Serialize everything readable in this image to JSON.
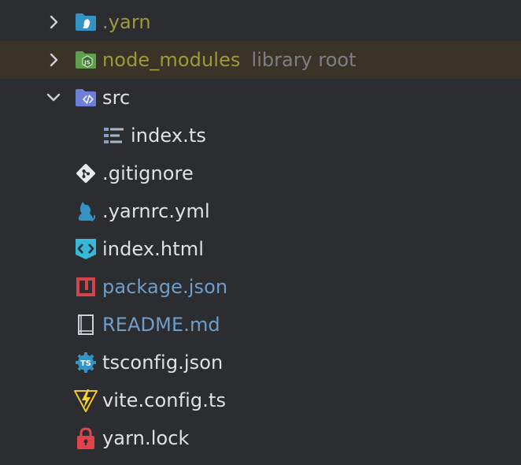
{
  "project_tree": {
    "items": [
      {
        "label": ".yarn",
        "icon": "folder-yarn-icon",
        "expanded": false,
        "status": "excluded"
      },
      {
        "label": "node_modules",
        "hint": "library root",
        "icon": "folder-node-modules-icon",
        "expanded": false,
        "status": "excluded",
        "selected": true
      },
      {
        "label": "src",
        "icon": "folder-src-icon",
        "expanded": true
      },
      {
        "label": "index.ts",
        "icon": "typescript-file-icon"
      },
      {
        "label": ".gitignore",
        "icon": "git-icon"
      },
      {
        "label": ".yarnrc.yml",
        "icon": "yarn-cat-icon"
      },
      {
        "label": "index.html",
        "icon": "html-file-icon"
      },
      {
        "label": "package.json",
        "icon": "npm-icon",
        "status": "modified"
      },
      {
        "label": "README.md",
        "icon": "readme-book-icon",
        "status": "modified"
      },
      {
        "label": "tsconfig.json",
        "icon": "tsconfig-icon"
      },
      {
        "label": "vite.config.ts",
        "icon": "vite-icon"
      },
      {
        "label": "yarn.lock",
        "icon": "lock-icon"
      }
    ]
  },
  "colors": {
    "background": "#2b2d30",
    "selected_row": "#3a3327",
    "text_default": "#dfe1e5",
    "text_excluded": "#9e9a38",
    "text_modified": "#6f9ec9",
    "text_hint": "#7c7f85"
  }
}
